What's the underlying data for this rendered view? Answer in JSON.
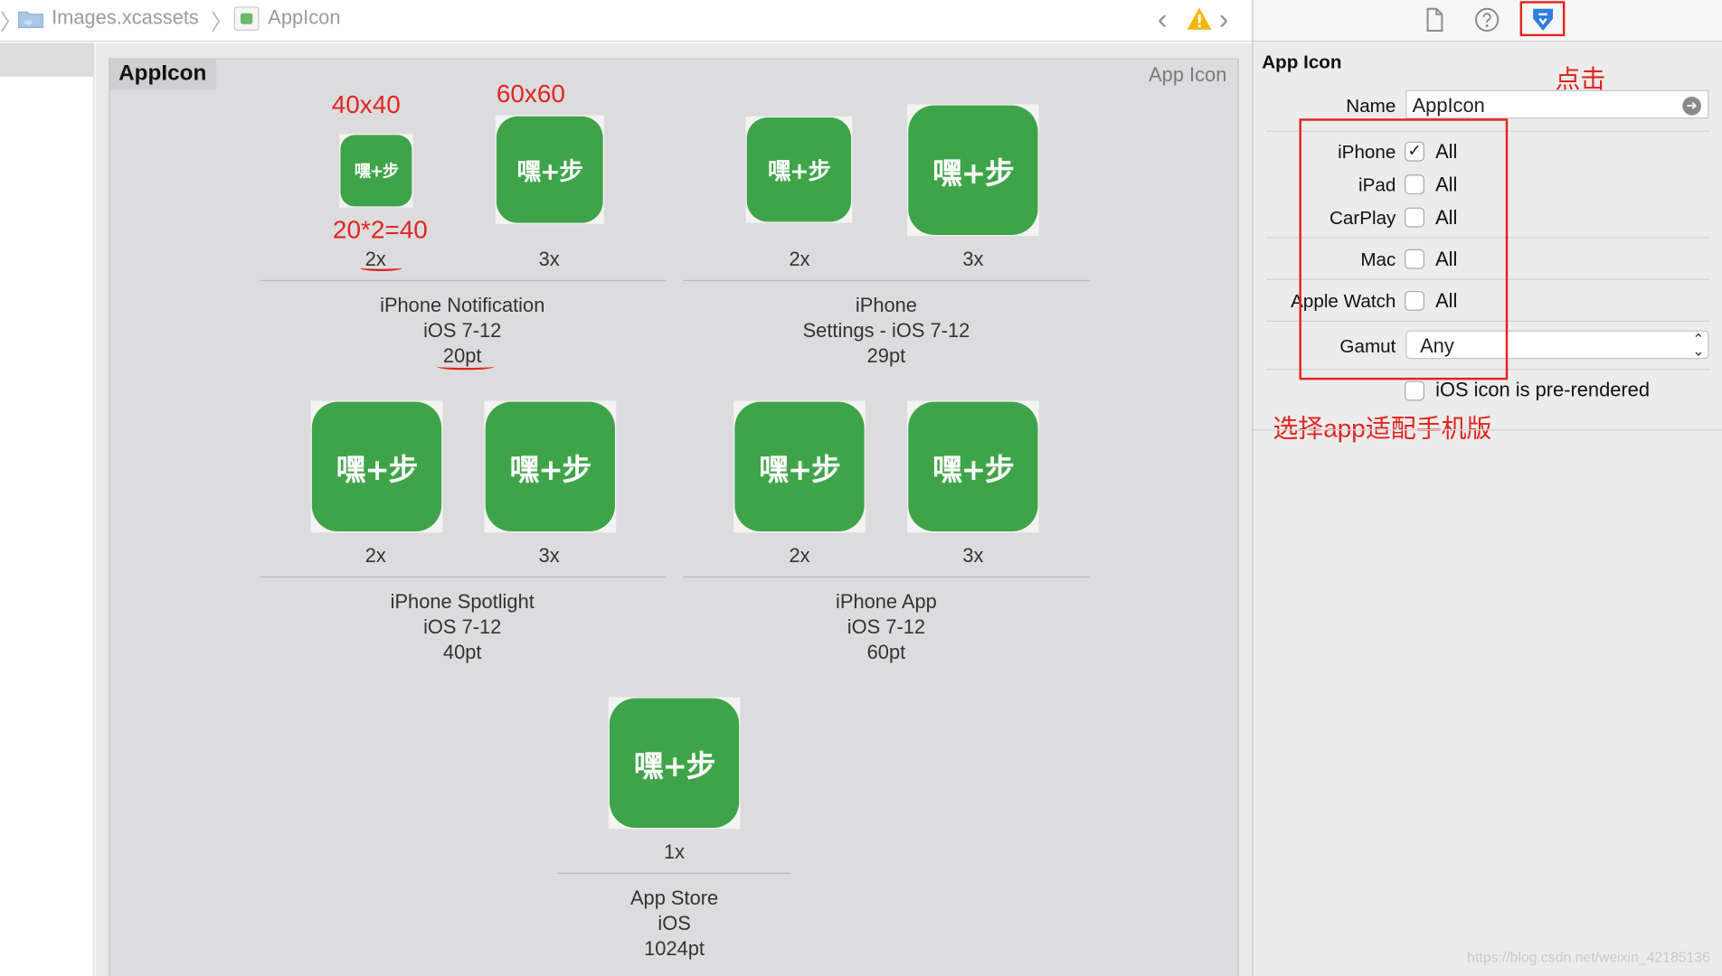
{
  "breadcrumb": {
    "folder": "Images.xcassets",
    "asset": "AppIcon"
  },
  "asset_set": {
    "title": "AppIcon",
    "kind": "App Icon"
  },
  "icon_glyph": "嘿+步",
  "groups": [
    {
      "name": "iPhone Notification",
      "os": "iOS 7-12",
      "size": "20pt",
      "scales": [
        "2x",
        "3x"
      ]
    },
    {
      "name": "iPhone",
      "os": "Settings - iOS 7-12",
      "size": "29pt",
      "scales": [
        "2x",
        "3x"
      ]
    },
    {
      "name": "iPhone Spotlight",
      "os": "iOS 7-12",
      "size": "40pt",
      "scales": [
        "2x",
        "3x"
      ]
    },
    {
      "name": "iPhone App",
      "os": "iOS 7-12",
      "size": "60pt",
      "scales": [
        "2x",
        "3x"
      ]
    },
    {
      "name": "App Store",
      "os": "iOS",
      "size": "1024pt",
      "scales": [
        "1x"
      ]
    }
  ],
  "annotations": {
    "size_2x": "40x40",
    "size_3x": "60x60",
    "formula": "20*2=40",
    "click_hint": "点击",
    "select_hint": "选择app适配手机版"
  },
  "inspector": {
    "section_title": "App Icon",
    "name_label": "Name",
    "name_value": "AppIcon",
    "devices": [
      {
        "label": "iPhone",
        "option": "All",
        "checked": true
      },
      {
        "label": "iPad",
        "option": "All",
        "checked": false
      },
      {
        "label": "CarPlay",
        "option": "All",
        "checked": false
      },
      {
        "label": "Mac",
        "option": "All",
        "checked": false
      },
      {
        "label": "Apple Watch",
        "option": "All",
        "checked": false
      }
    ],
    "gamut_label": "Gamut",
    "gamut_value": "Any",
    "prerendered_label": "iOS icon is pre-rendered",
    "prerendered_checked": false
  },
  "watermark": "https://blog.csdn.net/weixin_42185136",
  "colors": {
    "icon_green": "#3fa449",
    "annotation_red": "#e0251f",
    "selected_tab_blue": "#2f7de1"
  }
}
